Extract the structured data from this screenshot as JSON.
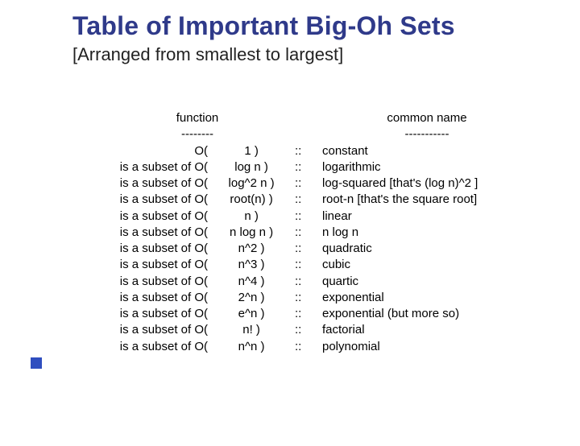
{
  "title": "Table of Important Big-Oh Sets",
  "subtitle": "[Arranged from smallest to largest]",
  "headers": {
    "function": "function",
    "function_dash": "--------",
    "common_name": "common name",
    "common_name_dash": "-----------"
  },
  "sep": "::",
  "rows": [
    {
      "prefix": "O(",
      "fn": "1",
      "suffix": ")",
      "name": "constant"
    },
    {
      "prefix": "is a subset of O(",
      "fn": "log n",
      "suffix": ")",
      "name": "logarithmic"
    },
    {
      "prefix": "is a subset of O(",
      "fn": "log^2 n",
      "suffix": ")",
      "name": "log-squared [that's (log n)^2 ]"
    },
    {
      "prefix": "is a subset of O(",
      "fn": "root(n)",
      "suffix": ")",
      "name": "root-n [that's the square root]"
    },
    {
      "prefix": "is a subset of O(",
      "fn": "n",
      "suffix": ")",
      "name": "linear"
    },
    {
      "prefix": "is a subset of O(",
      "fn": "n log n",
      "suffix": ")",
      "name": "n log n"
    },
    {
      "prefix": "is a subset of O(",
      "fn": "n^2",
      "suffix": ")",
      "name": "quadratic"
    },
    {
      "prefix": "is a subset of O(",
      "fn": "n^3",
      "suffix": ")",
      "name": "cubic"
    },
    {
      "prefix": "is a subset of O(",
      "fn": "n^4",
      "suffix": ")",
      "name": "quartic"
    },
    {
      "prefix": "is a subset of O(",
      "fn": "2^n",
      "suffix": ")",
      "name": "exponential"
    },
    {
      "prefix": "is a subset of O(",
      "fn": "e^n",
      "suffix": ")",
      "name": "exponential (but more so)"
    },
    {
      "prefix": "is a subset of O(",
      "fn": "n!",
      "suffix": ")",
      "name": "factorial"
    },
    {
      "prefix": "is a subset of O(",
      "fn": "n^n",
      "suffix": ")",
      "name": "polynomial"
    }
  ]
}
